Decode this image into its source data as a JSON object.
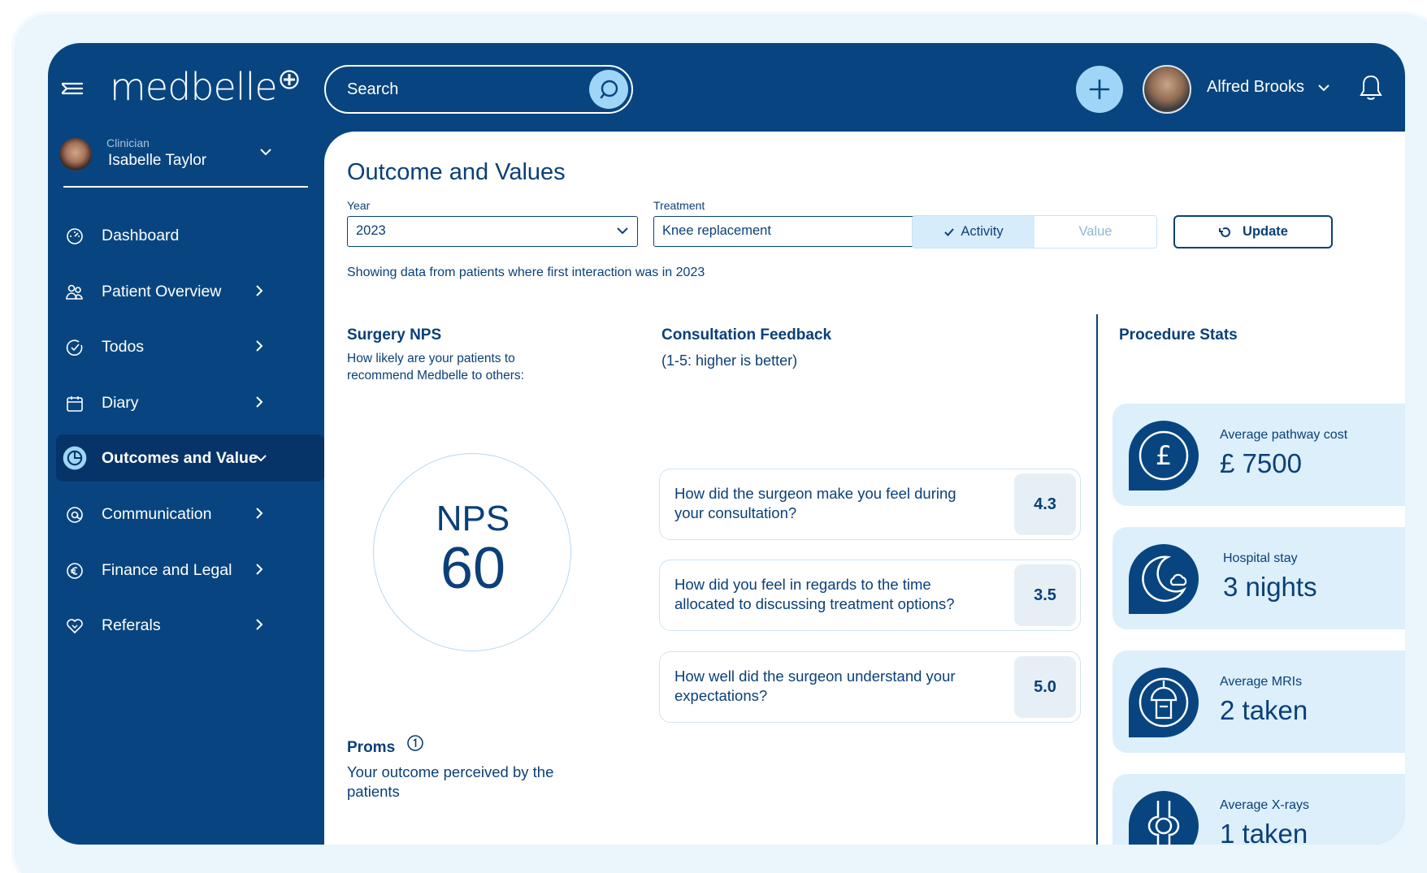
{
  "app": {
    "logo": "medbelle"
  },
  "search": {
    "placeholder": "Search"
  },
  "user": {
    "name": "Alfred Brooks"
  },
  "clinician": {
    "role": "Clinician",
    "name": "Isabelle Taylor"
  },
  "sidebar": {
    "items": [
      {
        "label": "Dashboard"
      },
      {
        "label": "Patient Overview"
      },
      {
        "label": "Todos"
      },
      {
        "label": "Diary"
      },
      {
        "label": "Outcomes and Value"
      },
      {
        "label": "Communication"
      },
      {
        "label": "Finance and Legal"
      },
      {
        "label": "Referals"
      }
    ]
  },
  "page": {
    "title": "Outcome and Values",
    "year_label": "Year",
    "year_value": "2023",
    "treatment_label": "Treatment",
    "treatment_value": "Knee replacement",
    "toggle_activity": "Activity",
    "toggle_value": "Value",
    "update_label": "Update",
    "note": "Showing data from patients where first interaction was in 2023"
  },
  "nps": {
    "title": "Surgery NPS",
    "subtitle_line1": "How likely are your patients to",
    "subtitle_line2": "recommend Medbelle to others:",
    "label": "NPS",
    "value": "60"
  },
  "feedback": {
    "title": "Consultation Feedback",
    "subtitle": "(1-5: higher is better)",
    "items": [
      {
        "question": "How did the surgeon make you feel during your consultation?",
        "score": "4.3"
      },
      {
        "question": "How did you feel in regards to the time allocated to discussing treatment options?",
        "score": "3.5"
      },
      {
        "question": "How well did the surgeon understand your expectations?",
        "score": "5.0"
      }
    ]
  },
  "proms": {
    "title": "Proms",
    "subtitle_line1": "Your outcome perceived by the",
    "subtitle_line2": "patients"
  },
  "stats": {
    "title": "Procedure Stats",
    "items": [
      {
        "label": "Average pathway cost",
        "value": "£ 7500",
        "icon": "pound-icon"
      },
      {
        "label": "Hospital stay",
        "value": "3 nights",
        "icon": "moon-cloud-icon"
      },
      {
        "label": "Average MRIs",
        "value": "2 taken",
        "icon": "mri-scanner-icon"
      },
      {
        "label": "Average X-rays",
        "value": "1 taken",
        "icon": "knee-joint-icon"
      }
    ]
  },
  "colors": {
    "navy": "#084580",
    "accent": "#9fd5f6",
    "card": "#dceffb"
  }
}
